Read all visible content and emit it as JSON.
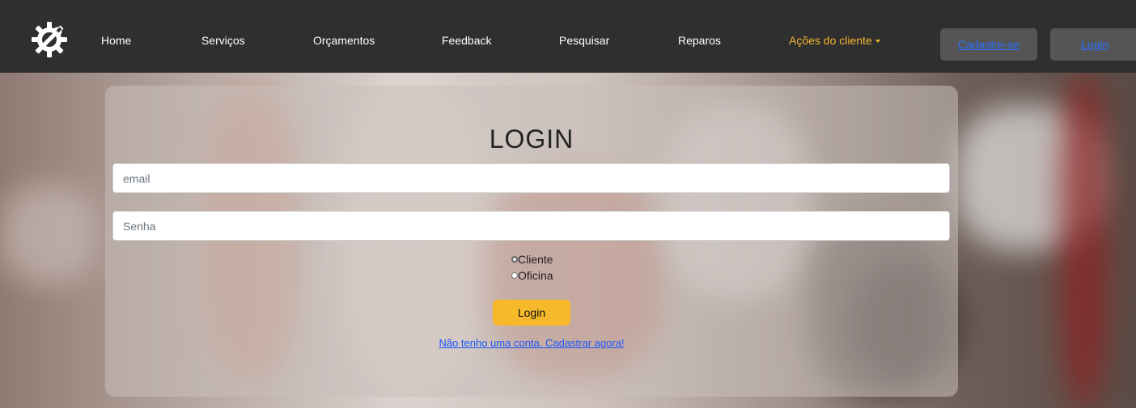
{
  "navbar": {
    "logo_icon": "gear-wrench-icon",
    "links": [
      "Home",
      "Serviços",
      "Orçamentos",
      "Feedback",
      "Pesquisar",
      "Reparos"
    ],
    "client_actions": "Ações do cliente",
    "signup_button": "Cadastre-se",
    "login_button": "Login",
    "accent_color": "#f2b632"
  },
  "login": {
    "title": "LOGIN",
    "email_placeholder": "email",
    "password_placeholder": "Senha",
    "account_types": [
      {
        "label": "Cliente",
        "checked": true
      },
      {
        "label": "Oficina",
        "checked": false
      }
    ],
    "submit_label": "Login",
    "signup_link": "Não tenho uma conta. Cadastrar agora!",
    "button_color": "#f6b92b"
  }
}
